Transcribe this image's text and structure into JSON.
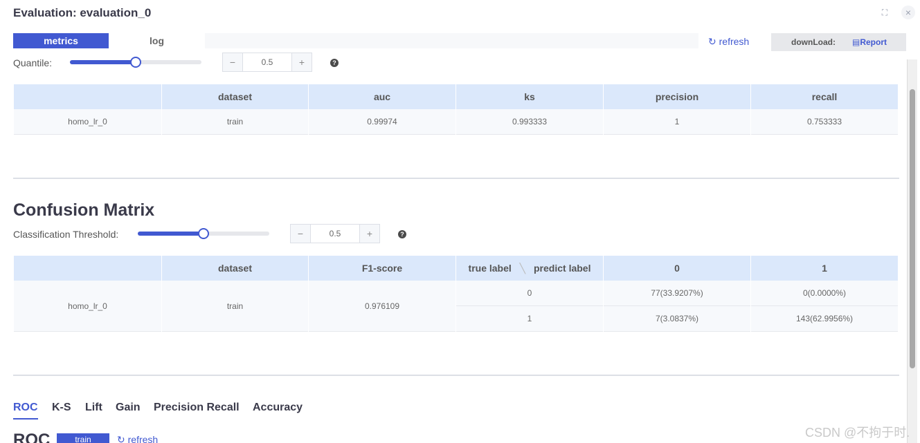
{
  "window": {
    "title": "Evaluation: evaluation_0",
    "expand_icon": "fullscreen-icon",
    "close_icon": "close-icon"
  },
  "tabs": [
    {
      "label": "metrics",
      "active": true
    },
    {
      "label": "log",
      "active": false
    }
  ],
  "toolbar": {
    "refresh_label": "refresh",
    "download_label": "downLoad:",
    "report_label": "Report"
  },
  "quantile": {
    "label": "Quantile:",
    "value": "0.5",
    "level_fraction": 0.5
  },
  "metrics_table": {
    "headers": [
      "",
      "dataset",
      "auc",
      "ks",
      "precision",
      "recall"
    ],
    "rows": [
      [
        "homo_lr_0",
        "train",
        "0.99974",
        "0.993333",
        "1",
        "0.753333"
      ]
    ]
  },
  "confusion": {
    "title": "Confusion Matrix",
    "threshold_label": "Classification Threshold:",
    "threshold_value": "0.5",
    "level_fraction": 0.5,
    "headers": [
      "",
      "dataset",
      "F1-score",
      "true label",
      "predict label",
      "0",
      "1"
    ],
    "row": {
      "model": "homo_lr_0",
      "dataset": "train",
      "f1": "0.976109",
      "sub_rows": [
        {
          "label": "0",
          "c0": "77(33.9207%)",
          "c1": "0(0.0000%)"
        },
        {
          "label": "1",
          "c0": "7(3.0837%)",
          "c1": "143(62.9956%)"
        }
      ]
    }
  },
  "chart_tabs": [
    "ROC",
    "K-S",
    "Lift",
    "Gain",
    "Precision Recall",
    "Accuracy"
  ],
  "roc": {
    "title": "ROC",
    "badge": "train",
    "refresh_label": "refresh"
  },
  "watermark": "CSDN @不拘于时."
}
